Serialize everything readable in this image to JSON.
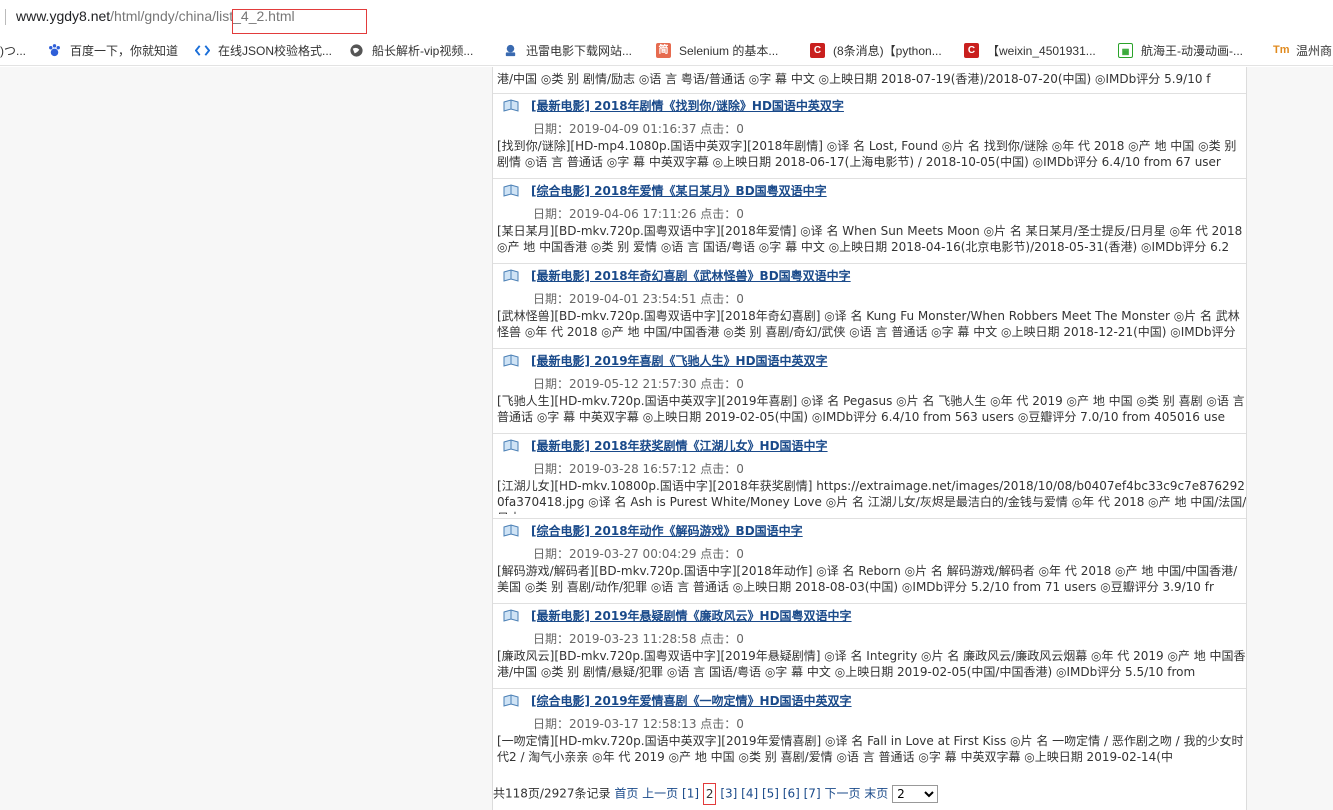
{
  "address": {
    "host": "www.ygdy8.net",
    "path_pre": "/html/gndy/china/",
    "path_hl": "list_4_2.html"
  },
  "bookmarks": [
    {
      "label": ")つ...",
      "icon": "page-icon",
      "color": "#999999"
    },
    {
      "label": "百度一下，你就知道",
      "icon": "baidu-paw-icon",
      "color": "#2f5fd8"
    },
    {
      "label": "在线JSON校验格式...",
      "icon": "json-diamond-icon",
      "color": "#1a6ed8"
    },
    {
      "label": "船长解析-vip视频...",
      "icon": "globe-icon",
      "color": "#555555"
    },
    {
      "label": "迅雷电影下载网站...",
      "icon": "thunder-icon",
      "color": "#3a6ab0"
    },
    {
      "label": "Selenium 的基本...",
      "icon": "jianshu-icon",
      "color": "#e66b4f"
    },
    {
      "label": "(8条消息)【python...",
      "icon": "csdn-icon",
      "color": "#c9201e"
    },
    {
      "label": "【weixin_4501931...",
      "icon": "csdn-icon",
      "color": "#c9201e"
    },
    {
      "label": "航海王-动漫动画-...",
      "icon": "video-icon",
      "color": "#2aa32a"
    },
    {
      "label": "温州商",
      "icon": "tm-icon",
      "color": "#e08a1e"
    }
  ],
  "topline": "港/中国 ◎类 别 剧情/励志 ◎语 言 粤语/普通话 ◎字 幕 中文 ◎上映日期 2018-07-19(香港)/2018-07-20(中国) ◎IMDb评分 5.9/10 f",
  "items": [
    {
      "title": "[最新电影] 2018年剧情《找到你/谜除》HD国语中英双字",
      "meta": "日期：2019-04-09 01:16:37 点击：0",
      "desc": "[找到你/谜除][HD-mp4.1080p.国语中英双字][2018年剧情] ◎译 名 Lost, Found ◎片 名 找到你/谜除 ◎年 代 2018 ◎产 地 中国 ◎类 别 剧情 ◎语 言 普通话 ◎字 幕 中英双字幕 ◎上映日期 2018-06-17(上海电影节) / 2018-10-05(中国) ◎IMDb评分 6.4/10 from 67 user"
    },
    {
      "title": "[综合电影] 2018年爱情《某日某月》BD国粤双语中字",
      "meta": "日期：2019-04-06 17:11:26 点击：0",
      "desc": "[某日某月][BD-mkv.720p.国粤双语中字][2018年爱情] ◎译 名 When Sun Meets Moon ◎片 名 某日某月/圣士提反/日月星 ◎年 代 2018 ◎产 地 中国香港 ◎类 别 爱情 ◎语 言 国语/粤语 ◎字 幕 中文 ◎上映日期 2018-04-16(北京电影节)/2018-05-31(香港) ◎IMDb评分 6.2"
    },
    {
      "title": "[最新电影] 2018年奇幻喜剧《武林怪兽》BD国粤双语中字",
      "meta": "日期：2019-04-01 23:54:51 点击：0",
      "desc": "[武林怪兽][BD-mkv.720p.国粤双语中字][2018年奇幻喜剧] ◎译 名 Kung Fu Monster/When Robbers Meet The Monster ◎片 名 武林怪兽 ◎年 代 2018 ◎产 地 中国/中国香港 ◎类 别 喜剧/奇幻/武侠 ◎语 言 普通话 ◎字 幕 中文 ◎上映日期 2018-12-21(中国) ◎IMDb评分"
    },
    {
      "title": "[最新电影] 2019年喜剧《飞驰人生》HD国语中英双字",
      "meta": "日期：2019-05-12 21:57:30 点击：0",
      "desc": "[飞驰人生][HD-mkv.720p.国语中英双字][2019年喜剧] ◎译 名 Pegasus ◎片 名 飞驰人生 ◎年 代 2019 ◎产 地 中国 ◎类 别 喜剧 ◎语 言 普通话 ◎字 幕 中英双字幕 ◎上映日期 2019-02-05(中国) ◎IMDb评分 6.4/10 from 563 users ◎豆瓣评分 7.0/10 from 405016 use"
    },
    {
      "title": "[最新电影] 2018年获奖剧情《江湖儿女》HD国语中字",
      "meta": "日期：2019-03-28 16:57:12 点击：0",
      "desc": "[江湖儿女][HD-mkv.10800p.国语中字][2018年获奖剧情] https://extraimage.net/images/2018/10/08/b0407ef4bc33c9c7e8762920fa370418.jpg ◎译 名 Ash is Purest White/Money Love ◎片 名 江湖儿女/灰烬是最洁白的/金钱与爱情 ◎年 代 2018 ◎产 地 中国/法国/日本 ◎"
    },
    {
      "title": "[综合电影] 2018年动作《解码游戏》BD国语中字",
      "meta": "日期：2019-03-27 00:04:29 点击：0",
      "desc": "[解码游戏/解码者][BD-mkv.720p.国语中字][2018年动作] ◎译 名 Reborn ◎片 名 解码游戏/解码者 ◎年 代 2018 ◎产 地 中国/中国香港/美国 ◎类 别 喜剧/动作/犯罪 ◎语 言 普通话 ◎上映日期 2018-08-03(中国) ◎IMDb评分 5.2/10 from 71 users ◎豆瓣评分 3.9/10 fr"
    },
    {
      "title": "[最新电影] 2019年悬疑剧情《廉政风云》HD国粤双语中字",
      "meta": "日期：2019-03-23 11:28:58 点击：0",
      "desc": "[廉政风云][BD-mkv.720p.国粤双语中字][2019年悬疑剧情] ◎译 名 Integrity ◎片 名 廉政风云/廉政风云烟幕 ◎年 代 2019 ◎产 地 中国香港/中国 ◎类 别 剧情/悬疑/犯罪 ◎语 言 国语/粤语 ◎字 幕 中文 ◎上映日期 2019-02-05(中国/中国香港) ◎IMDb评分 5.5/10 from"
    },
    {
      "title": "[综合电影] 2019年爱情喜剧《一吻定情》HD国语中英双字",
      "meta": "日期：2019-03-17 12:58:13 点击：0",
      "desc": "[一吻定情][HD-mkv.720p.国语中英双字][2019年爱情喜剧] ◎译 名 Fall in Love at First Kiss ◎片 名 一吻定情 / 恶作剧之吻 / 我的少女时代2 / 淘气小亲亲 ◎年 代 2019 ◎产 地 中国 ◎类 别 喜剧/爱情 ◎语 言 普通话 ◎字 幕 中英双字幕 ◎上映日期 2019-02-14(中"
    }
  ],
  "pager": {
    "summary": "共118页/2927条记录",
    "first": "首页",
    "prev": "上一页",
    "p1": "[1]",
    "current": "2",
    "p3": "[3]",
    "p4": "[4]",
    "p5": "[5]",
    "p6": "[6]",
    "p7": "[7]",
    "next": "下一页",
    "last": "末页",
    "select_value": "2"
  }
}
